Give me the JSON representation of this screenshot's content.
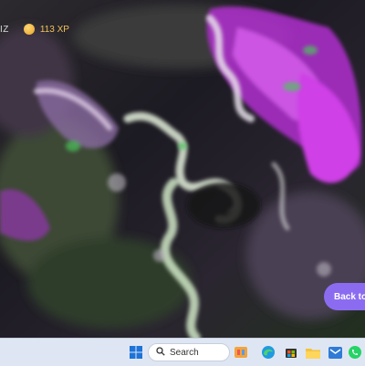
{
  "header": {
    "quiz_label": "IZ",
    "xp_text": "113 XP"
  },
  "actions": {
    "back_label": "Back to"
  },
  "taskbar": {
    "search_placeholder": "Search",
    "icons": [
      "windows-start-icon",
      "search-icon",
      "widgets-icon",
      "edge-icon",
      "store-icon",
      "file-explorer-icon",
      "mail-icon",
      "whatsapp-icon"
    ]
  },
  "colors": {
    "accent": "#8b6cf0",
    "xp_gold": "#f0c25a",
    "taskbar": "#dfe6f3"
  }
}
